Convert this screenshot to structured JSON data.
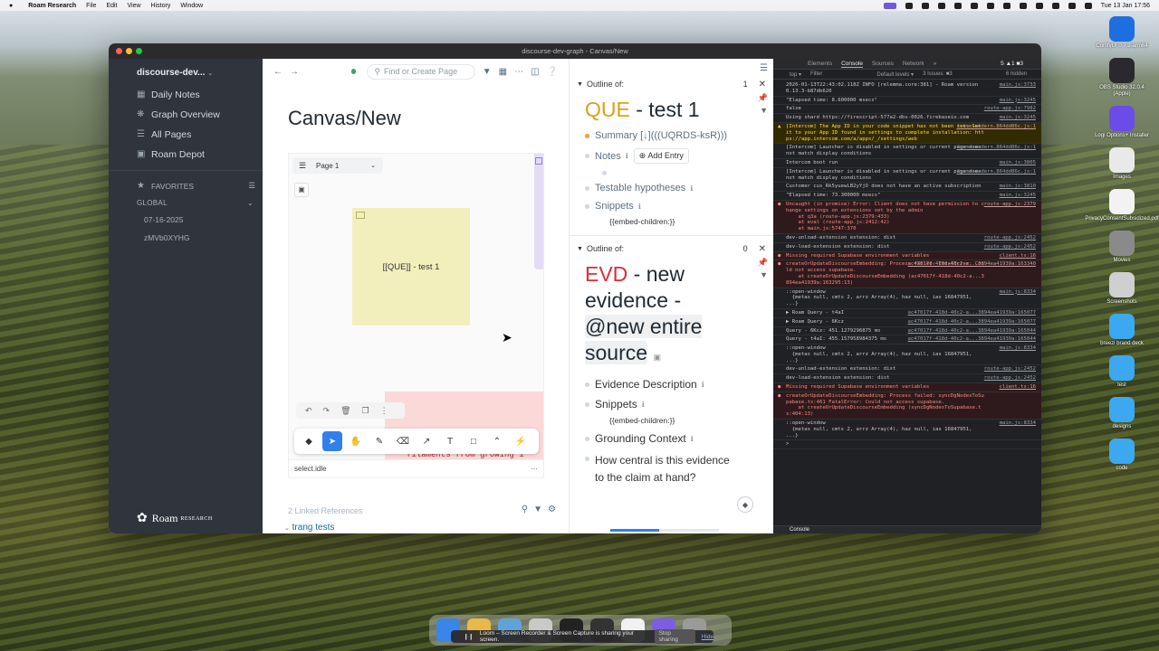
{
  "menubar": {
    "apple": "",
    "app_name": "Roam Research",
    "menus": [
      "File",
      "Edit",
      "View",
      "History",
      "Window"
    ],
    "clock": "Tue 13 Jan 17:56"
  },
  "desktop_icons": [
    {
      "label": "ComfyUI 0.7.2-arm64",
      "icon": "comfyui-icon",
      "color": "#1d6fe0"
    },
    {
      "label": "OBS Studio 32.0.4 (Apple)",
      "icon": "obs-icon",
      "color": "#2a2a2e"
    },
    {
      "label": "Logi Options+ Installer",
      "icon": "logi-icon",
      "color": "#6b4ce6"
    },
    {
      "label": "Images",
      "icon": "file-icon",
      "color": "#e9e9e9"
    },
    {
      "label": "PrivacyConsentSubsidized.pdf",
      "icon": "pdf-icon",
      "color": "#f2f2f2"
    },
    {
      "label": "Movies",
      "icon": "movie-thumb-icon",
      "color": "#8a8a8a"
    },
    {
      "label": "Screenshots",
      "icon": "screenshot-thumb-icon",
      "color": "#cfcfcf"
    },
    {
      "label": "breezi brand deck",
      "icon": "folder-icon",
      "color": "#3ca8ef"
    },
    {
      "label": "test",
      "icon": "folder-icon",
      "color": "#3ca8ef"
    },
    {
      "label": "designs",
      "icon": "folder-icon",
      "color": "#3ca8ef"
    },
    {
      "label": "code",
      "icon": "folder-icon",
      "color": "#3ca8ef"
    }
  ],
  "window": {
    "title": "discourse-dev-graph - Canvas/New"
  },
  "sidebar": {
    "graph_name": "discourse-dev...",
    "items": [
      {
        "label": "Daily Notes",
        "icon": "calendar-icon"
      },
      {
        "label": "Graph Overview",
        "icon": "graph-icon"
      },
      {
        "label": "All Pages",
        "icon": "list-icon"
      },
      {
        "label": "Roam Depot",
        "icon": "store-icon"
      }
    ],
    "favorites_label": "FAVORITES",
    "global_label": "GLOBAL",
    "global_items": [
      "07-16-2025",
      "zMVb0XYHG"
    ],
    "logo_text": "Roam",
    "logo_sub": "RESEARCH"
  },
  "topbar": {
    "search_placeholder": "Find or Create Page"
  },
  "main": {
    "page_title": "Canvas/New",
    "canvas": {
      "page_selector": "Page 1",
      "yellow_note": "[[QUE]] - test 1",
      "pink_text": "filaments from growing i",
      "status_text": "select.idle",
      "status_menu": "···"
    },
    "linked_refs": "2 Linked References",
    "ref_item": "trang tests"
  },
  "right_panel": {
    "outline1": {
      "label": "Outline of:",
      "count": "1",
      "title_prefix": "QUE",
      "title_rest": " - test 1",
      "summary": "Summary [↓](((UQRDS-ksR)))",
      "notes": "Notes",
      "add_entry": "Add Entry",
      "testable": "Testable hypotheses",
      "snippets": "Snippets",
      "embed": "{{embed-children:}}"
    },
    "outline2": {
      "label": "Outline of:",
      "count": "0",
      "title_prefix": "EVD",
      "title_rest": " - new evidence - ",
      "title_hl": "@new entire source",
      "evidence_desc": "Evidence Description",
      "snippets": "Snippets",
      "embed": "{{embed-children:}}",
      "grounding": "Grounding Context",
      "question": "How central is this evidence to the claim at hand?"
    },
    "progress_fraction": 0.45
  },
  "devtools": {
    "tabs": [
      "Elements",
      "Console",
      "Sources",
      "Network",
      "»"
    ],
    "issues": "5 ▲1 ■3",
    "toolbar": [
      "top ▾",
      "Filter",
      "Default levels ▾",
      "3 Issues: ■3",
      "6 hidden"
    ],
    "logs": [
      {
        "t": "info",
        "text": "2026-01-13T22:43:02.118Z INFO [relemma.core:381] - Roam version 0.13.3-b87db620",
        "src": "main.js:3733"
      },
      {
        "t": "info",
        "text": "\"Elapsed time: 8.600000 msecs\"",
        "src": "main.js:3245"
      },
      {
        "t": "info",
        "text": "false",
        "src": "route-app.js:7982"
      },
      {
        "t": "info",
        "text": "Using shard https://firescript-577a2-dbs-0026.firebaseio.com",
        "src": "main.js:3245"
      },
      {
        "t": "warn",
        "text": "[Intercom] The App ID in your code snippet has not been set. Set it to your App ID found in settings to complete installation: https://app.intercom.com/a/apps/_/settings/web",
        "src": "frame-modern.864dd86c.js:1"
      },
      {
        "t": "info",
        "text": "[Intercom] Launcher is disabled in settings or current page does not match display conditions",
        "src": "frame-modern.864dd86c.js:1"
      },
      {
        "t": "info",
        "text": "Intercom boot run",
        "src": "main.js:3805"
      },
      {
        "t": "info",
        "text": "[Intercom] Launcher is disabled in settings or current page does not match display conditions",
        "src": "frame-modern.864dd86c.js:1"
      },
      {
        "t": "info",
        "text": "Customer cus_Rk5yuewLB2yYjO does not have an active subscription",
        "src": "main.js:3810"
      },
      {
        "t": "info",
        "text": "\"Elapsed time: 73.300000 msecs\"",
        "src": "main.js:3245"
      },
      {
        "t": "err",
        "text": "Uncaught (in promise) Error: Client does not have permission to change settings on extensions set by the admin\n    at q3a (route-app.js:2379:433)\n    at eval (route-app.js:2412:42)\n    at main.js:5747:370",
        "src": "route-app.js:2379"
      },
      {
        "t": "info",
        "text": "dev-unload-extension extension: dist",
        "src": "route-app.js:2452"
      },
      {
        "t": "info",
        "text": "dev-load-extension extension: dist",
        "src": "route-app.js:2452"
      },
      {
        "t": "err",
        "text": "Missing required Supabase environment variables",
        "src": "client.ts:16"
      },
      {
        "t": "err",
        "text": "createOrUpdateDiscourseEmbedding: Process failed: FatalError: Could not access supabase.\n    at createOrUpdateDiscourseEmbedding (ac47017f-418d-40c2-a...3894ea41939a:163295:13)",
        "src": "ac47017f-418d-40c2-a...3894ea41939a:163340"
      },
      {
        "t": "info",
        "text": "::open-window\n  {metas null, cmts 2, arrz Array(4), haz null, ias 16847951, ...}",
        "src": "main.js:8334"
      },
      {
        "t": "info",
        "text": "▶ Roam Query - t4aI",
        "src": "ac47017f-418d-40c2-a...3894ea41939a:165077"
      },
      {
        "t": "info",
        "text": "▶ Roam Query - 6Kcz",
        "src": "ac47017f-418d-40c2-a...3894ea41939a:165077"
      },
      {
        "t": "info",
        "text": "Query - 6Kcz: 451.1279296875 ms",
        "src": "ac47017f-418d-40c2-a...3894ea41939a:165044"
      },
      {
        "t": "info",
        "text": "Query - t4aI: 455.157958984375 ms",
        "src": "ac47017f-418d-40c2-a...3894ea41939a:165044"
      },
      {
        "t": "info",
        "text": "::open-window\n  {metas null, cmts 2, arrz Array(4), haz null, ias 16847951, ...}",
        "src": "main.js:8334"
      },
      {
        "t": "info",
        "text": "dev-unload-extension extension: dist",
        "src": "route-app.js:2452"
      },
      {
        "t": "info",
        "text": "dev-load-extension extension: dist",
        "src": "route-app.js:2452"
      },
      {
        "t": "err",
        "text": "Missing required Supabase environment variables",
        "src": "client.ts:16"
      },
      {
        "t": "err",
        "text": "createOrUpdateDiscourseEmbedding: Process failed: syncDgNodesToSupabase.ts:461 FatalError: Could not access supabase.\n    at createOrUpdateDiscourseEmbedding (syncDgNodesToSupabase.ts:404:13)",
        "src": ""
      },
      {
        "t": "info",
        "text": "::open-window\n  {metas null, cmts 2, arrz Array(4), haz null, ias 16847951, ...}",
        "src": "main.js:8334"
      },
      {
        "t": "info",
        "text": ">",
        "src": ""
      }
    ],
    "console_drawer": "Console"
  },
  "loom": {
    "text": "Loom – Screen Recorder & Screen Capture is sharing your screen.",
    "stop": "Stop sharing",
    "hide": "Hide"
  },
  "colors": {
    "sidebar": "#30343c",
    "accent": "#2f80ed",
    "que": "#d8a11a",
    "evd": "#d62f3b"
  }
}
